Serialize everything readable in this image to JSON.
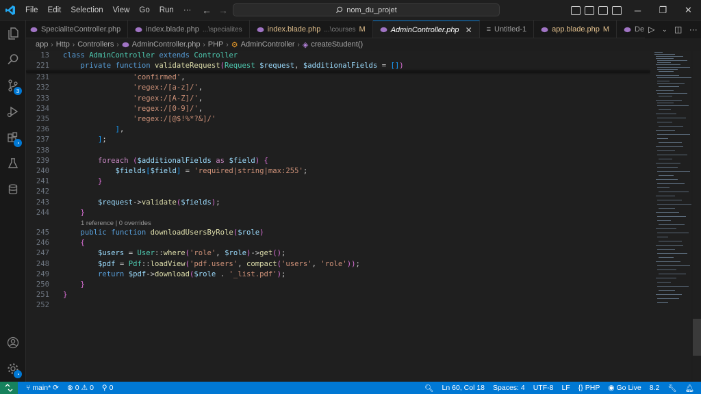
{
  "menu": [
    "File",
    "Edit",
    "Selection",
    "View",
    "Go",
    "Run",
    "···"
  ],
  "search_text": "nom_du_projet",
  "tabs": [
    {
      "name": "SpecialiteController.php",
      "desc": "",
      "mod": "",
      "active": false
    },
    {
      "name": "index.blade.php",
      "desc": "...\\specialites",
      "mod": "",
      "active": false
    },
    {
      "name": "index.blade.php",
      "desc": "...\\courses",
      "mod": "M",
      "active": false
    },
    {
      "name": "AdminController.php",
      "desc": "",
      "mod": "",
      "active": true
    },
    {
      "name": "Untitled-1",
      "desc": "",
      "mod": "",
      "active": false
    },
    {
      "name": "app.blade.php",
      "desc": "",
      "mod": "M",
      "active": false
    },
    {
      "name": "De",
      "desc": "",
      "mod": "",
      "active": false
    }
  ],
  "breadcrumb": [
    "app",
    "Http",
    "Controllers",
    "AdminController.php",
    "PHP",
    "AdminController",
    "createStudent()"
  ],
  "source_control_badge": "3",
  "code_lens": "1 reference | 0 overrides",
  "lines": [
    {
      "n": "13",
      "t": "class AdminController extends Controller"
    },
    {
      "n": "221",
      "t": "    private function validateRequest(Request $request, $additionalFields = [])"
    },
    {
      "n": "231",
      "t": "                'confirmed',"
    },
    {
      "n": "232",
      "t": "                'regex:/[a-z]/',"
    },
    {
      "n": "233",
      "t": "                'regex:/[A-Z]/',"
    },
    {
      "n": "234",
      "t": "                'regex:/[0-9]/',"
    },
    {
      "n": "235",
      "t": "                'regex:/[@$!%*?&]/'"
    },
    {
      "n": "236",
      "t": "            ],"
    },
    {
      "n": "237",
      "t": "        ];"
    },
    {
      "n": "238",
      "t": ""
    },
    {
      "n": "239",
      "t": "        foreach ($additionalFields as $field) {"
    },
    {
      "n": "240",
      "t": "            $fields[$field] = 'required|string|max:255';"
    },
    {
      "n": "241",
      "t": "        }"
    },
    {
      "n": "242",
      "t": ""
    },
    {
      "n": "243",
      "t": "        $request->validate($fields);"
    },
    {
      "n": "244",
      "t": "    }"
    },
    {
      "n": "245",
      "t": "    public function downloadUsersByRole($role)"
    },
    {
      "n": "246",
      "t": "    {"
    },
    {
      "n": "247",
      "t": "        $users = User::where('role', $role)->get();"
    },
    {
      "n": "248",
      "t": "        $pdf = Pdf::loadView('pdf.users', compact('users', 'role'));"
    },
    {
      "n": "249",
      "t": "        return $pdf->download($role . '_list.pdf');"
    },
    {
      "n": "250",
      "t": "    }"
    },
    {
      "n": "251",
      "t": "}"
    },
    {
      "n": "252",
      "t": ""
    }
  ],
  "status": {
    "branch": "main*",
    "errors": "0",
    "warnings": "0",
    "ports": "0",
    "position": "Ln 60, Col 18",
    "spaces": "Spaces: 4",
    "encoding": "UTF-8",
    "eol": "LF",
    "language": "PHP",
    "golive": "Go Live",
    "version": "8.2"
  },
  "colors": {
    "accent": "#0078d4",
    "statusbar": "#0078d4",
    "editor_bg": "#1f1f1f",
    "php_icon": "#a074c4"
  },
  "icons": {
    "activity": [
      "explorer-icon",
      "search-icon",
      "source-control-icon",
      "run-debug-icon",
      "extensions-icon",
      "testing-icon",
      "database-icon",
      "account-icon",
      "settings-icon"
    ]
  }
}
